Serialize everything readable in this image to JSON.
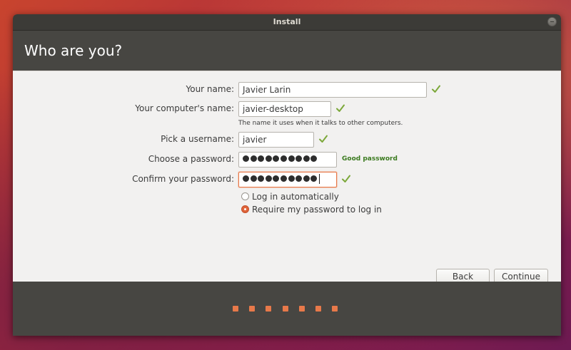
{
  "window": {
    "title": "Install"
  },
  "header": {
    "title": "Who are you?"
  },
  "form": {
    "name": {
      "label": "Your name:",
      "value": "Javier Larin"
    },
    "computer": {
      "label": "Your computer's name:",
      "value": "javier-desktop",
      "hint": "The name it uses when it talks to other computers."
    },
    "username": {
      "label": "Pick a username:",
      "value": "javier"
    },
    "password": {
      "label": "Choose a password:",
      "strength": "Good password",
      "length": 10
    },
    "confirm": {
      "label": "Confirm your password:",
      "length": 10
    },
    "login_options": [
      {
        "label": "Log in automatically",
        "selected": false
      },
      {
        "label": "Require my password to log in",
        "selected": true
      }
    ]
  },
  "buttons": {
    "back": "Back",
    "continue": "Continue"
  },
  "progress": {
    "total_steps": 7,
    "accent": "#e8794a"
  },
  "icons": {
    "valid": "checkmark-icon",
    "close": "close-icon"
  },
  "colors": {
    "accent": "#e8794a",
    "valid_green": "#7ca83a",
    "strength_green": "#3a7a1e"
  }
}
